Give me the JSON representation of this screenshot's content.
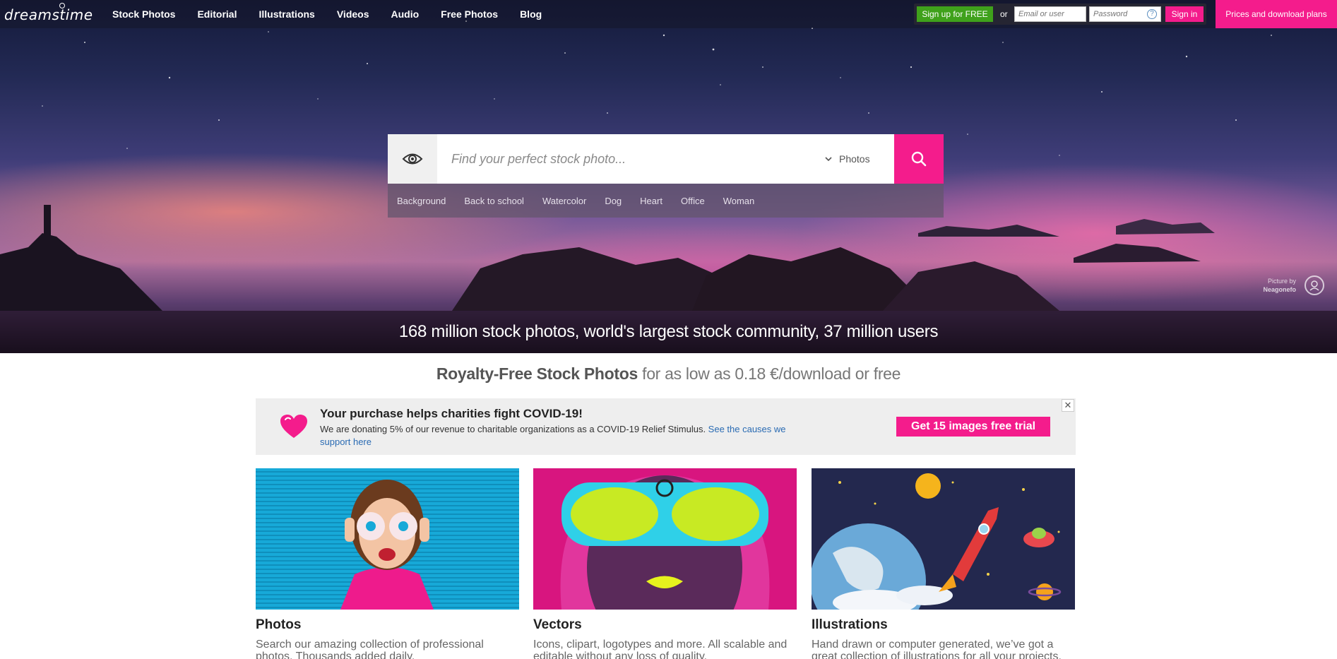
{
  "header": {
    "logo": "dreamstime",
    "nav": [
      "Stock Photos",
      "Editorial",
      "Illustrations",
      "Videos",
      "Audio",
      "Free Photos",
      "Blog"
    ],
    "signup_label": "Sign up for FREE",
    "or_label": "or",
    "email_placeholder": "Email or user",
    "password_placeholder": "Password",
    "help_label": "?",
    "signin_label": "Sign in",
    "prices_label": "Prices and download plans"
  },
  "search": {
    "placeholder": "Find your perfect stock photo...",
    "type_selected": "Photos",
    "tags": [
      "Background",
      "Back to school",
      "Watercolor",
      "Dog",
      "Heart",
      "Office",
      "Woman"
    ]
  },
  "hero": {
    "caption": "168 million stock photos, world's largest stock community, 37 million users",
    "credit_line1": "Picture by",
    "credit_line2": "Neagonefo"
  },
  "tagline": {
    "bold": "Royalty-Free Stock Photos",
    "rest": " for as low as 0.18 €/download or free"
  },
  "covid": {
    "title": "Your purchase helps charities fight COVID-19!",
    "text": "We are donating 5% of our revenue to charitable organizations as a COVID-19 Relief Stimulus. ",
    "link": "See the causes we support here",
    "cta": "Get 15 images free trial",
    "close": "✕"
  },
  "cards": [
    {
      "title": "Photos",
      "desc": "Search our amazing collection of professional photos. Thousands added daily."
    },
    {
      "title": "Vectors",
      "desc": "Icons, clipart, logotypes and more. All scalable and editable without any loss of quality."
    },
    {
      "title": "Illustrations",
      "desc": "Hand drawn or computer generated, we’ve got a great collection of illustrations for all your projects."
    }
  ],
  "colors": {
    "brand_pink": "#f41c8c",
    "signup_green": "#3fa11b"
  }
}
